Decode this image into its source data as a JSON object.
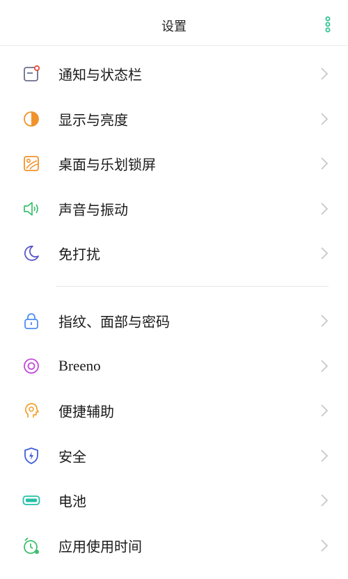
{
  "header": {
    "title": "设置",
    "more_icon": "more-vertical-icon"
  },
  "colors": {
    "more_dots": "#2fc38f",
    "chevron": "#c8c8c8",
    "notification": "#6a6f8a",
    "display": "#f0922b",
    "wallpaper": "#f0922b",
    "sound": "#3cbf6d",
    "dnd": "#5a55c9",
    "fingerprint": "#4d8df2",
    "breeno": "#c24bd8",
    "accessibility": "#f2a12a",
    "security": "#3f5fd9",
    "battery": "#25c0a8",
    "screen_time": "#3cbf6d"
  },
  "group1": [
    {
      "label": "通知与状态栏",
      "icon": "notification-icon"
    },
    {
      "label": "显示与亮度",
      "icon": "brightness-icon"
    },
    {
      "label": "桌面与乐划锁屏",
      "icon": "wallpaper-icon"
    },
    {
      "label": "声音与振动",
      "icon": "speaker-icon"
    },
    {
      "label": "免打扰",
      "icon": "moon-icon"
    }
  ],
  "group2": [
    {
      "label": "指纹、面部与密码",
      "icon": "lock-icon"
    },
    {
      "label": "Breeno",
      "icon": "breeno-icon"
    },
    {
      "label": "便捷辅助",
      "icon": "assist-icon"
    },
    {
      "label": "安全",
      "icon": "shield-icon"
    },
    {
      "label": "电池",
      "icon": "battery-icon"
    },
    {
      "label": "应用使用时间",
      "icon": "clock-icon"
    }
  ]
}
